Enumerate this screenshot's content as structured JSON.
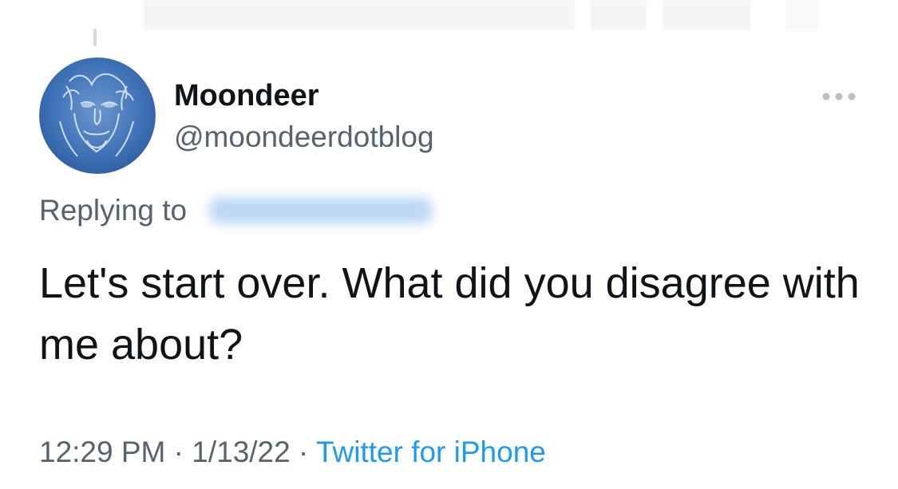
{
  "tweet": {
    "author": {
      "display_name": "Moondeer",
      "handle": "@moondeerdotblog",
      "avatar_icon": "bearded-face-avatar-icon"
    },
    "more_icon": "more-horizontal-icon",
    "replying_label": "Replying to",
    "text": "Let's start over. What did you disagree with me about?",
    "time": "12:29 PM",
    "date": "1/13/22",
    "separator": "·",
    "source": "Twitter for iPhone"
  },
  "colors": {
    "primary_text": "#0f1419",
    "secondary_text": "#536471",
    "link": "#1d9bf0",
    "avatar_blue": "#3a6fb5"
  }
}
